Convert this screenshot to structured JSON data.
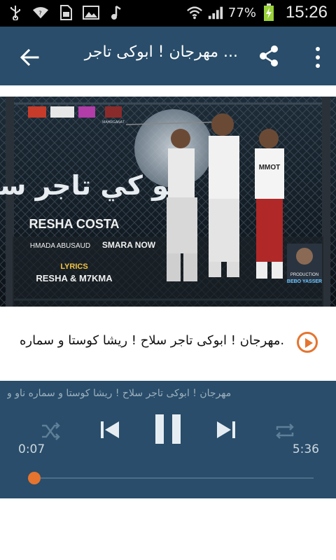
{
  "status": {
    "battery_pct": "77%",
    "time": "15:26"
  },
  "appbar": {
    "title": "مهرجان ! ابوكى تاجر ..."
  },
  "thumbnail": {
    "poster_title": "ابو كي تاجر سلاح",
    "artist": "RESHA COSTA",
    "feat_left": "HMADA ABUSAUD",
    "feat_right": "SMARA NOW",
    "lyrics_label": "LYRICS",
    "lyrics_names": "RESHA & M7KMA",
    "production_label": "PRODUCTION",
    "production_name": "BEBO YASSER",
    "logo_label": "MAHRGANAT",
    "shirt_text": "MMOT"
  },
  "track": {
    "title": "مهرجان ! ابوكى تاجر سلاح ! ريشا كوستا و سماره..."
  },
  "player": {
    "now_playing": "مهرجان ! ابوكى تاجر سلاح ! ريشا كوستا و سماره ناو و",
    "elapsed": "0:07",
    "duration": "5:36",
    "progress": 0.021
  },
  "colors": {
    "appbar": "#294d6a",
    "accent": "#e5742f"
  }
}
